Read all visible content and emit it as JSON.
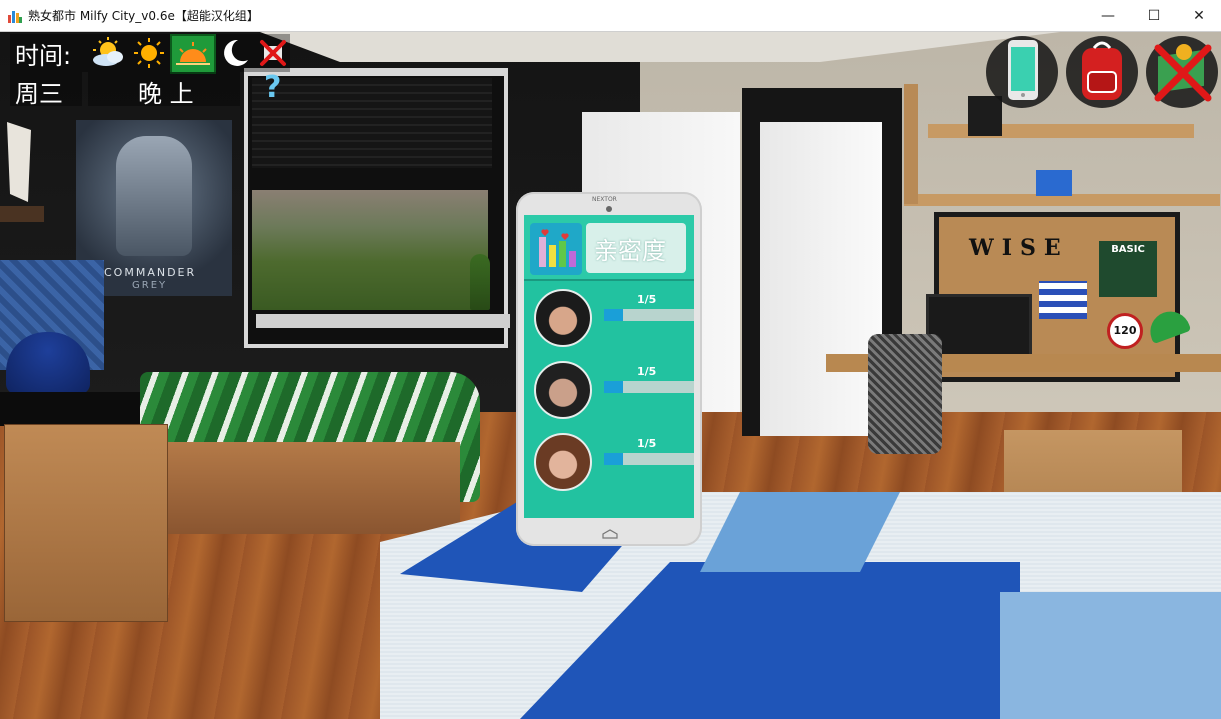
{
  "window": {
    "title": "熟女都市 Milfy City_v0.6e【超能汉化组】",
    "minimize_glyph": "—",
    "maximize_glyph": "☐",
    "close_glyph": "✕"
  },
  "hud": {
    "time_label": "时间:",
    "day": "周三",
    "period": "晚 上",
    "unknown_marker": "?",
    "time_icons": [
      "sun-cloud-icon",
      "sun-icon",
      "sunset-icon",
      "moon-icon",
      "crossed-icon"
    ],
    "active_time_icon": "sunset-icon"
  },
  "top_right": {
    "icons": [
      "phone-icon",
      "backpack-icon",
      "map-pin-crossed-icon"
    ]
  },
  "room": {
    "poster_text": "COMMANDER",
    "poster_text_2": "GREY",
    "board_text": "WISE",
    "board_badge": "BASIC",
    "board_number": "120"
  },
  "phone": {
    "brand": "NEXTOR",
    "app_title": "亲密度",
    "characters": [
      {
        "value_label": "1/5",
        "progress": 0.2,
        "hair": "#1b1b1b",
        "skin": "#d7a68a"
      },
      {
        "value_label": "1/5",
        "progress": 0.2,
        "hair": "#202020",
        "skin": "#caa08a"
      },
      {
        "value_label": "1/5",
        "progress": 0.2,
        "hair": "#6a3b24",
        "skin": "#e2b49c"
      }
    ]
  },
  "colors": {
    "phone_screen": "#22c2a0",
    "bar_fill": "#1a9fd8",
    "rug_blue": "#1f55b8",
    "floor": "#a05a2c"
  }
}
